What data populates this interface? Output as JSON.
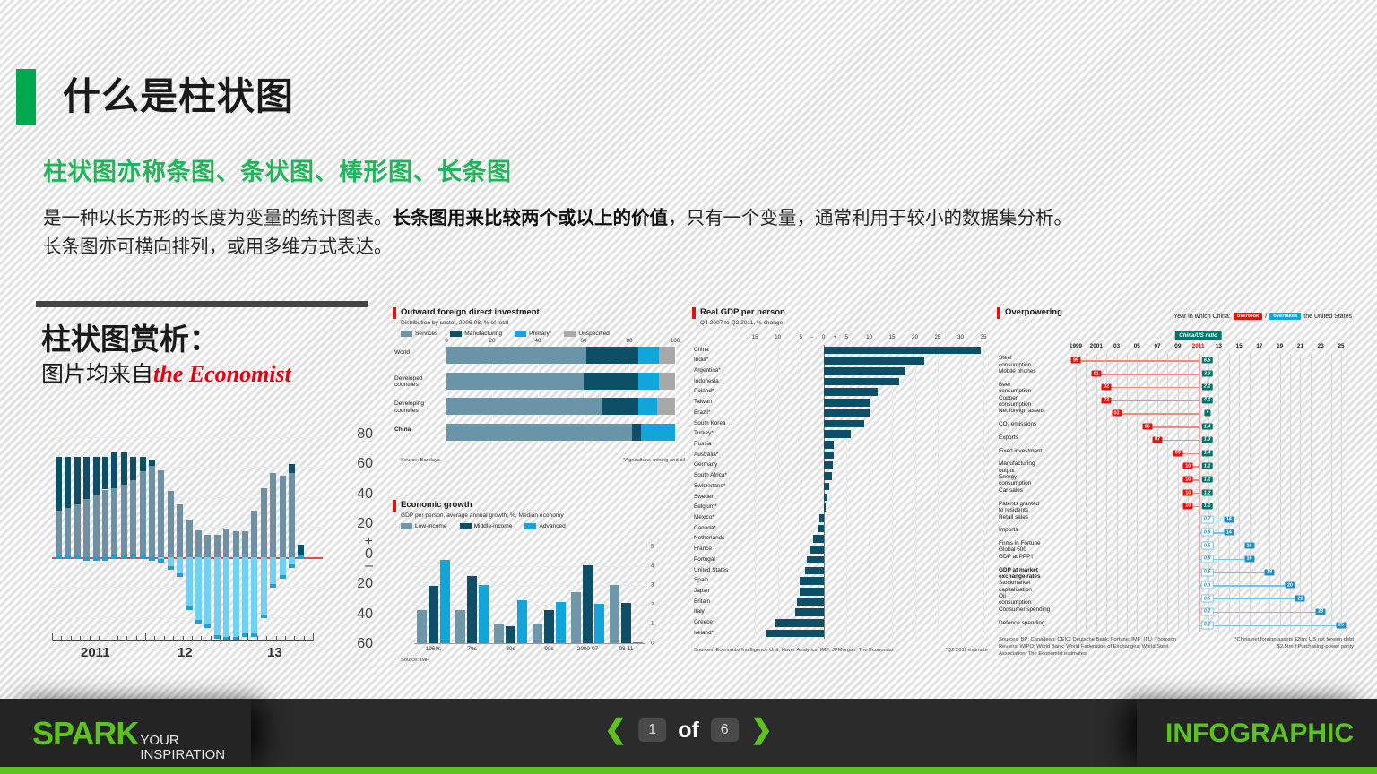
{
  "header": {
    "title": "什么是柱状图",
    "subtitle_green": "柱状图亦称条图、条状图、棒形图、长条图",
    "paragraph_line1_a": "是一种以长方形的长度为变量的统计图表。",
    "paragraph_line1_b": "长条图用来比较两个或以上的价值",
    "paragraph_line1_c": "，只有一个变量，通常利用于较小的数据集分析。",
    "paragraph_line2": "长条图亦可横向排列，或用多维方式表达。",
    "accent_green": "#00a94f"
  },
  "left_panel": {
    "section_title": "柱状图赏析：",
    "section_sub_prefix": "图片均来自",
    "section_sub_brand": "the Economist",
    "brand_color": "#e3000f"
  },
  "footer": {
    "brand_main": "SPARK",
    "brand_sub_1": "YOUR",
    "brand_sub_2": "INSPIRATION",
    "right_label": "INFOGRAPHIC",
    "prev_icon": "chevron-left-icon",
    "next_icon": "chevron-right-icon",
    "current_page": "1",
    "of_label": "of",
    "total_pages": "6",
    "green": "#5cc21e"
  },
  "chart_data": [
    {
      "id": "diverging",
      "type": "bar",
      "title": "",
      "subtitle": "",
      "xlabel": "",
      "ylabel": "",
      "ylim": [
        -60,
        80
      ],
      "yticks": [
        "80",
        "60",
        "40",
        "20",
        "+",
        "0",
        "–",
        "20",
        "40",
        "60"
      ],
      "xticks": [
        "2011",
        "12",
        "13"
      ],
      "grid": true,
      "zero_line_color": "#e8483c",
      "series": [
        {
          "name": "dark-top",
          "color": "#0c4f66",
          "values": [
            36,
            34,
            32,
            28,
            25,
            22,
            24,
            22,
            16,
            10,
            4,
            0,
            0,
            0,
            0,
            0,
            0,
            0,
            0,
            0,
            0,
            0,
            0,
            0,
            0,
            6,
            8
          ]
        },
        {
          "name": "mid",
          "color": "#6f8fa2",
          "values": [
            31,
            33,
            35,
            39,
            42,
            45,
            46,
            48,
            51,
            57,
            61,
            58,
            44,
            35,
            25,
            18,
            15,
            15,
            19,
            17,
            17,
            31,
            46,
            56,
            54,
            56
          ]
        },
        {
          "name": "negative",
          "color": "#6fd2f5",
          "values": [
            -1,
            -1,
            -1,
            -2,
            -2,
            -2,
            -1,
            -1,
            -1,
            -1,
            -2,
            -3,
            -8,
            -13,
            -35,
            -44,
            -47,
            -54,
            -55,
            -55,
            -53,
            -53,
            -40,
            -20,
            -14,
            -7,
            -1
          ]
        }
      ]
    },
    {
      "id": "fdi",
      "type": "bar",
      "orientation": "horizontal-stacked",
      "title": "Outward foreign direct investment",
      "subtitle": "Distribution by sector, 2006-08, % of total",
      "source": "Source: Barclays",
      "footnote": "*Agriculture, mining and oil",
      "xticks": [
        "0",
        "20",
        "40",
        "60",
        "80",
        "100"
      ],
      "xlim": [
        0,
        100
      ],
      "categories": [
        "World",
        "Developed countries",
        "Developing countries",
        "China"
      ],
      "legend": [
        {
          "label": "Services",
          "color": "#6a94a8"
        },
        {
          "label": "Manufacturing",
          "color": "#0c4f66"
        },
        {
          "label": "Primary*",
          "color": "#12a5dc"
        },
        {
          "label": "Unspecified",
          "color": "#a8a8a8"
        }
      ],
      "series": [
        {
          "name": "Services",
          "values": [
            61,
            60,
            68,
            81
          ]
        },
        {
          "name": "Manufacturing",
          "values": [
            23,
            24,
            16,
            4
          ]
        },
        {
          "name": "Primary*",
          "values": [
            9,
            9,
            8,
            15
          ]
        },
        {
          "name": "Unspecified",
          "values": [
            7,
            7,
            8,
            0
          ]
        }
      ]
    },
    {
      "id": "economic-growth",
      "type": "bar",
      "title": "Economic growth",
      "subtitle": "GDP per person, average annual growth, %, Median economy",
      "source": "Source: IMF",
      "categories": [
        "1960s",
        "70s",
        "80s",
        "90s",
        "2000-07",
        "08-11"
      ],
      "ylim": [
        0,
        5
      ],
      "yticks": [
        "0",
        "1",
        "2",
        "3",
        "4",
        "5"
      ],
      "legend": [
        {
          "label": "Low-income",
          "color": "#6f97aa"
        },
        {
          "label": "Middle-income",
          "color": "#0c4f66"
        },
        {
          "label": "Advanced",
          "color": "#12a5dc"
        }
      ],
      "series": [
        {
          "name": "Low-income",
          "values": [
            1.7,
            1.7,
            0.95,
            1.0,
            2.65,
            3.0
          ]
        },
        {
          "name": "Middle-income",
          "values": [
            2.95,
            3.45,
            0.9,
            1.7,
            4.05,
            2.1
          ]
        },
        {
          "name": "Advanced",
          "values": [
            4.3,
            3.0,
            2.2,
            2.15,
            2.05,
            0.05
          ]
        }
      ]
    },
    {
      "id": "real-gdp",
      "type": "bar",
      "orientation": "horizontal-diverging",
      "title": "Real GDP per person",
      "subtitle": "Q4 2007 to Q2 2011, % change",
      "source": "Sources: Economist Intelligence Unit; Haver Analytics; IMF; JPMorgan; The Economist",
      "footnote": "*Q2 2011 estimate",
      "xticks": [
        "15",
        "10",
        "5",
        "–",
        "0",
        "+",
        "5",
        "10",
        "15",
        "20",
        "25",
        "30",
        "35"
      ],
      "xlim": [
        -17,
        35
      ],
      "zero_line_color": "#e8483c",
      "categories": [
        "China",
        "India*",
        "Argentina*",
        "Indonesia",
        "Poland*",
        "Taiwan",
        "Brazil*",
        "South Korea",
        "Turkey*",
        "Russia",
        "Australia*",
        "Germany",
        "South Africa*",
        "Switzerland*",
        "Sweden",
        "Belgium*",
        "Mexico*",
        "Canada*",
        "Netherlands",
        "France",
        "Portugal",
        "United States",
        "Spain",
        "Japan",
        "Britain",
        "Italy",
        "Greece*",
        "Ireland*"
      ],
      "values": [
        34.5,
        22.0,
        18.0,
        16.5,
        11.8,
        10.3,
        10.0,
        9.0,
        6.0,
        2.3,
        2.2,
        2.0,
        1.8,
        1.2,
        0.8,
        0.4,
        -1.0,
        -1.3,
        -2.2,
        -2.8,
        -3.6,
        -4.0,
        -5.2,
        -5.3,
        -5.8,
        -6.2,
        -10.5,
        -12.5
      ]
    },
    {
      "id": "overpowering",
      "type": "dot-range",
      "title": "Overpowering",
      "header_prefix": "Year in which China:",
      "header_tag_red": "overtook",
      "header_tag_slash": "/",
      "header_tag_blue": "overtakes",
      "header_suffix": "the United States",
      "ratio_tag": "China/US ratio",
      "source": "Sources: BP; Canadean; CEIC; Deutsche Bank; Fortune; IMF; ITU; Thomson Reuters; WIPO; World Bank; World Federation of Exchanges; World Steel Association; The Economist estimates",
      "footnote": "*China net foreign assets $2trn; US net foreign debt $2.5trn †Purchasing-power parity",
      "xticks": [
        "1999",
        "2001",
        "03",
        "05",
        "07",
        "09",
        "2011",
        "13",
        "15",
        "17",
        "19",
        "21",
        "23",
        "25"
      ],
      "xlim": [
        1999,
        2025
      ],
      "rows": [
        {
          "label": "Steel consumption",
          "year": 1999,
          "year_chip": "99",
          "ratio": "6.6",
          "past": true
        },
        {
          "label": "Mobile phones",
          "year": 2001,
          "year_chip": "01",
          "ratio": "3.3",
          "past": true
        },
        {
          "label": "Beer consumption",
          "year": 2002,
          "year_chip": "02",
          "ratio": "2.1",
          "past": true
        },
        {
          "label": "Copper consumption",
          "year": 2002,
          "year_chip": "02",
          "ratio": "4.1",
          "past": true
        },
        {
          "label": "Net foreign assets",
          "year": 2003,
          "year_chip": "03",
          "ratio": "*",
          "past": true
        },
        {
          "label": "CO₂ emissions",
          "year": 2006,
          "year_chip": "06",
          "ratio": "1.4",
          "past": true
        },
        {
          "label": "Exports",
          "year": 2007,
          "year_chip": "07",
          "ratio": "1.3",
          "past": true
        },
        {
          "label": "Fixed investment",
          "year": 2009,
          "year_chip": "09",
          "ratio": "1.4",
          "past": true
        },
        {
          "label": "Manufacturing output",
          "year": 2010,
          "year_chip": "10",
          "ratio": "1.1",
          "past": true
        },
        {
          "label": "Energy consumption",
          "year": 2010,
          "year_chip": "10",
          "ratio": "1.1",
          "past": true
        },
        {
          "label": "Car sales",
          "year": 2010,
          "year_chip": "10",
          "ratio": "1.2",
          "past": true
        },
        {
          "label": "Patents granted to residents",
          "year": 2010,
          "year_chip": "10",
          "ratio": "1.1",
          "past": true
        },
        {
          "label": "Retail sales",
          "year": 2014,
          "year_chip": "14",
          "ratio": "0.7",
          "past": false
        },
        {
          "label": "Imports",
          "year": 2014,
          "year_chip": "14",
          "ratio": "0.8",
          "past": false
        },
        {
          "label": "Firms in Fortune Global 500",
          "year": 2016,
          "year_chip": "16",
          "ratio": "0.5",
          "past": false
        },
        {
          "label": "GDP at PPP†",
          "year": 2016,
          "year_chip": "16",
          "ratio": "0.8",
          "past": false
        },
        {
          "label": "GDP at market exchange rates",
          "year": 2018,
          "year_chip": "18",
          "ratio": "0.5",
          "past": false,
          "bold": true
        },
        {
          "label": "Stockmarket capitalisation",
          "year": 2020,
          "year_chip": "20",
          "ratio": "0.3",
          "past": false
        },
        {
          "label": "Oil consumption",
          "year": 2021,
          "year_chip": "21",
          "ratio": "0.5",
          "past": false
        },
        {
          "label": "Consumer spending",
          "year": 2023,
          "year_chip": "23",
          "ratio": "0.2",
          "past": false
        },
        {
          "label": "Defence spending",
          "year": 2025,
          "year_chip": "25",
          "ratio": "0.2",
          "past": false
        }
      ]
    }
  ]
}
